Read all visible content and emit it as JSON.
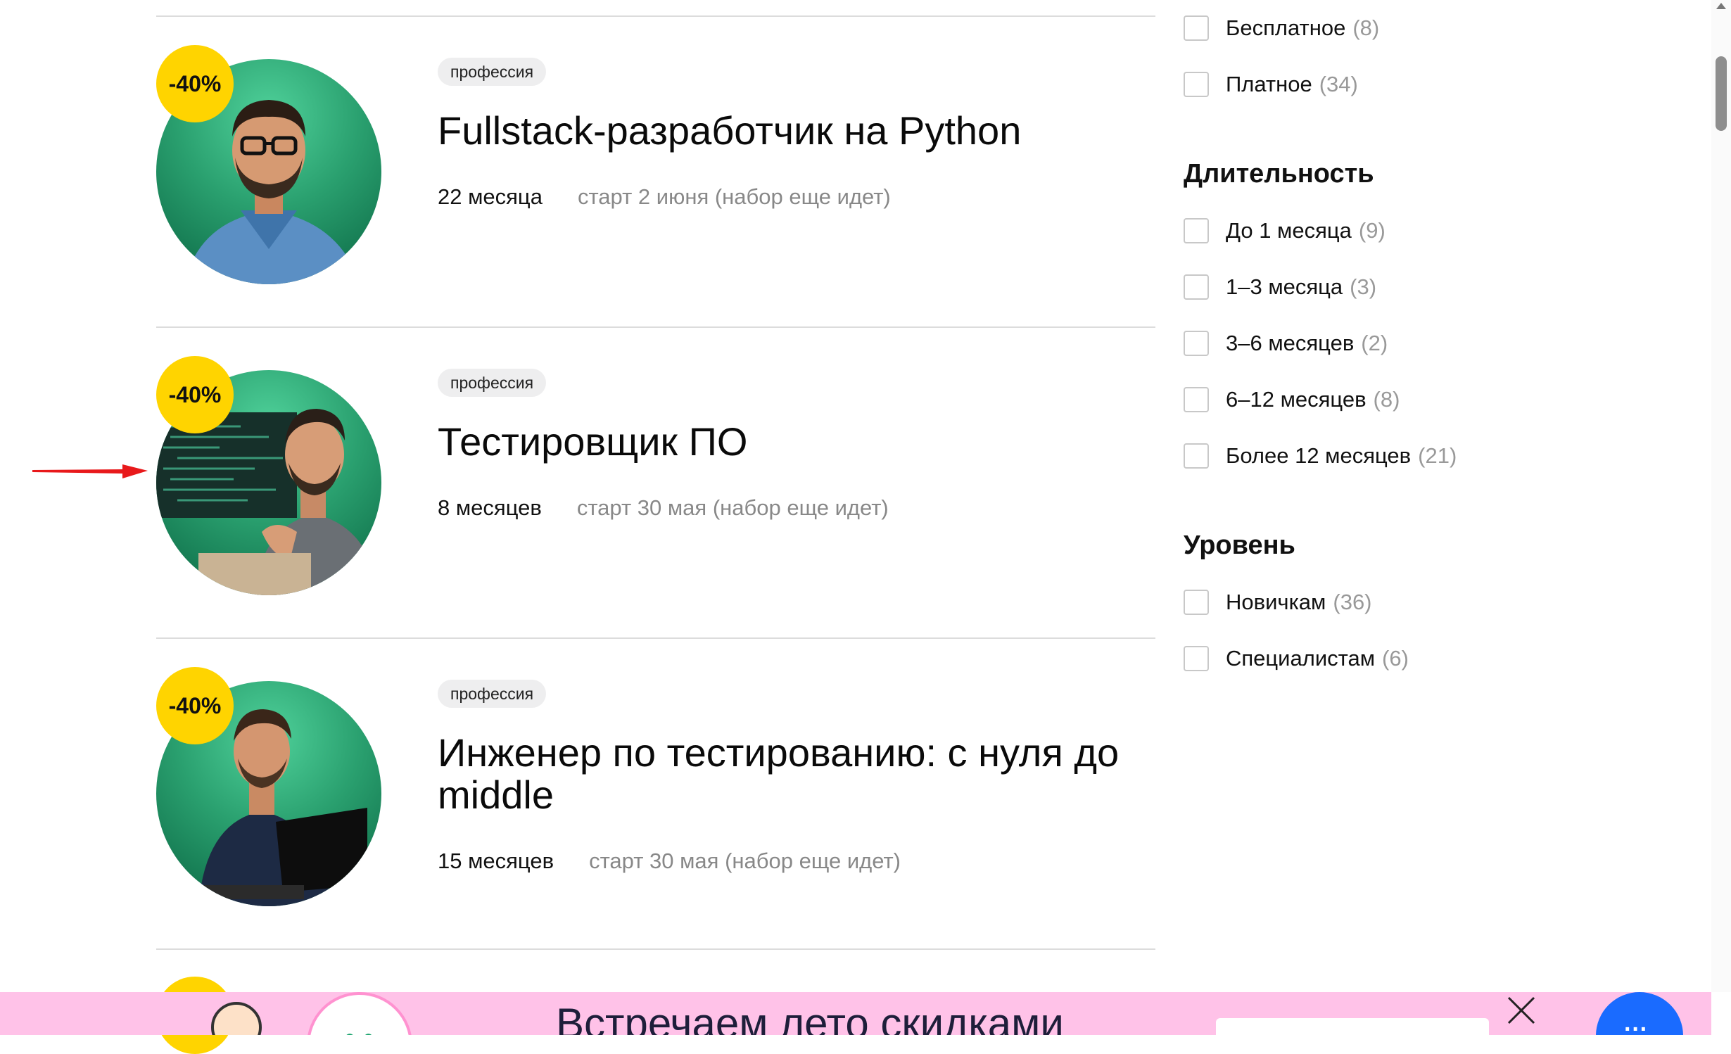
{
  "courses": [
    {
      "tag": "профессия",
      "title": "Fullstack-разработчик на Python",
      "duration": "22 месяца",
      "start": "старт 2 июня (набор еще идет)",
      "discount": "-40%"
    },
    {
      "tag": "профессия",
      "title": "Тестировщик ПО",
      "duration": "8 месяцев",
      "start": "старт 30 мая (набор еще идет)",
      "discount": "-40%"
    },
    {
      "tag": "профессия",
      "title": "Инженер по тестированию: с нуля до middle",
      "duration": "15 месяцев",
      "start": "старт 30 мая (набор еще идет)",
      "discount": "-40%"
    }
  ],
  "filters": {
    "price": [
      {
        "label": "Бесплатное",
        "count": "(8)",
        "checked": false
      },
      {
        "label": "Платное",
        "count": "(34)",
        "checked": false
      }
    ],
    "duration": {
      "heading": "Длительность",
      "options": [
        {
          "label": "До 1 месяца",
          "count": "(9)",
          "checked": false
        },
        {
          "label": "1–3 месяца",
          "count": "(3)",
          "checked": false
        },
        {
          "label": "3–6 месяцев",
          "count": "(2)",
          "checked": false
        },
        {
          "label": "6–12 месяцев",
          "count": "(8)",
          "checked": false
        },
        {
          "label": "Более 12 месяцев",
          "count": "(21)",
          "checked": false
        }
      ]
    },
    "level": {
      "heading": "Уровень",
      "options": [
        {
          "label": "Новичкам",
          "count": "(36)",
          "checked": false
        },
        {
          "label": "Специалистам",
          "count": "(6)",
          "checked": false
        }
      ]
    }
  },
  "promo": {
    "text": "Встречаем лето скидками"
  },
  "colors": {
    "discount_badge": "#ffd400",
    "tag_bg": "#eeeeef",
    "promo_bg": "#ffc2e8",
    "chat_button": "#1a6bff",
    "annotation_arrow": "#e8191b"
  }
}
